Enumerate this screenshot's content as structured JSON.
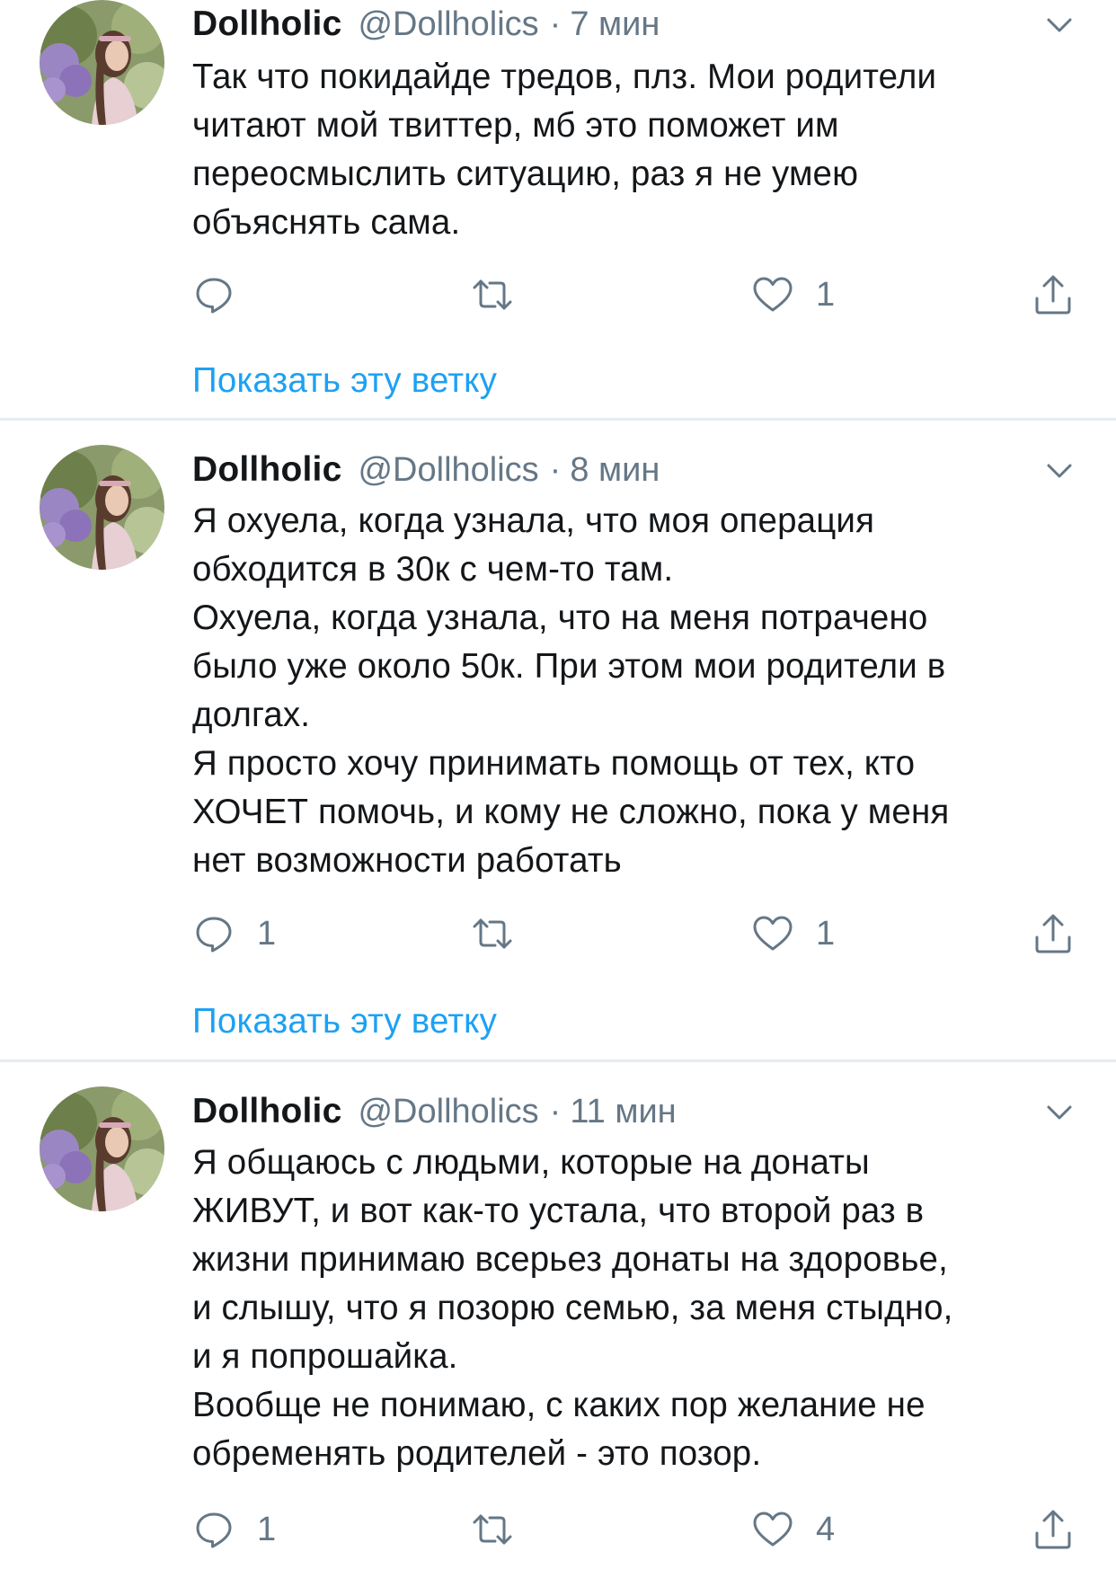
{
  "colors": {
    "text": "#14171a",
    "secondary": "#657786",
    "link": "#1da1f2",
    "divider": "#e6ecf0"
  },
  "icons": {
    "reply": "reply-icon",
    "retweet": "retweet-icon",
    "like": "heart-icon",
    "share": "share-icon",
    "menu": "chevron-down-icon"
  },
  "tweets": [
    {
      "name": "Dollholic",
      "handle": "@Dollholics",
      "separator": "·",
      "time": "7 мин",
      "lines": [
        "Так что покидайде тредов, плз. Мои родители",
        "читают мой твиттер, мб это поможет им",
        "переосмыслить ситуацию, раз я не умею",
        "объяснять сама."
      ],
      "replies": "",
      "retweets": "",
      "likes": "1",
      "show_thread": "Показать эту ветку"
    },
    {
      "name": "Dollholic",
      "handle": "@Dollholics",
      "separator": "·",
      "time": "8 мин",
      "lines": [
        "Я охуела, когда узнала, что моя операция",
        "обходится в 30к с чем-то там.",
        "Охуела, когда узнала, что на меня потрачено",
        "было уже около 50к. При этом мои родители в",
        "долгах.",
        "Я просто хочу принимать помощь от тех, кто",
        "ХОЧЕТ помочь, и кому не сложно, пока у меня",
        "нет возможности работать"
      ],
      "replies": "1",
      "retweets": "",
      "likes": "1",
      "show_thread": "Показать эту ветку"
    },
    {
      "name": "Dollholic",
      "handle": "@Dollholics",
      "separator": "·",
      "time": "11 мин",
      "lines": [
        "Я общаюсь с людьми, которые на донаты",
        "ЖИВУТ, и вот как-то устала, что второй раз в",
        "жизни принимаю всерьез донаты на здоровье,",
        "и слышу, что я позорю семью, за меня стыдно,",
        "и я попрошайка.",
        "Вообще не понимаю, с каких пор желание не",
        "обременять родителей - это позор."
      ],
      "replies": "1",
      "retweets": "",
      "likes": "4"
    }
  ]
}
